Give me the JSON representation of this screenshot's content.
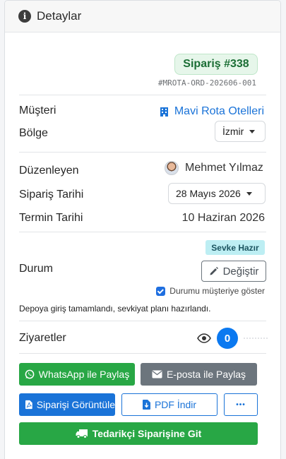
{
  "header": {
    "title": "Detaylar"
  },
  "order": {
    "badge": "Sipariş #338",
    "code": "#MROTA-ORD-202606-001"
  },
  "fields": {
    "customer_label": "Müşteri",
    "customer_value": "Mavi Rota Otelleri",
    "region_label": "Bölge",
    "region_value": "İzmir",
    "editor_label": "Düzenleyen",
    "editor_value": "Mehmet Yılmaz",
    "order_date_label": "Sipariş Tarihi",
    "order_date_value": "28 Mayıs 2026",
    "due_date_label": "Termin Tarihi",
    "due_date_value": "10 Haziran 2026"
  },
  "status": {
    "label": "Durum",
    "badge": "Sevke Hazır",
    "change_button": "Değiştir",
    "show_customer_checkbox": "Durumu müşteriye göster",
    "show_customer_checked": true,
    "note": "Depoya giriş tamamlandı, sevkiyat planı hazırlandı."
  },
  "visits": {
    "label": "Ziyaretler",
    "count": "0"
  },
  "actions": {
    "whatsapp": "WhatsApp ile Paylaş",
    "email": "E-posta ile Paylaş",
    "view_order": "Siparişi Görüntüle",
    "pdf": "PDF İndir",
    "more": "•••",
    "supplier": "Tedarikçi Siparişine Git"
  },
  "colors": {
    "primary": "#1a73d8",
    "success": "#28a745",
    "secondary": "#6c757d",
    "info_bg": "#bdeef3"
  }
}
